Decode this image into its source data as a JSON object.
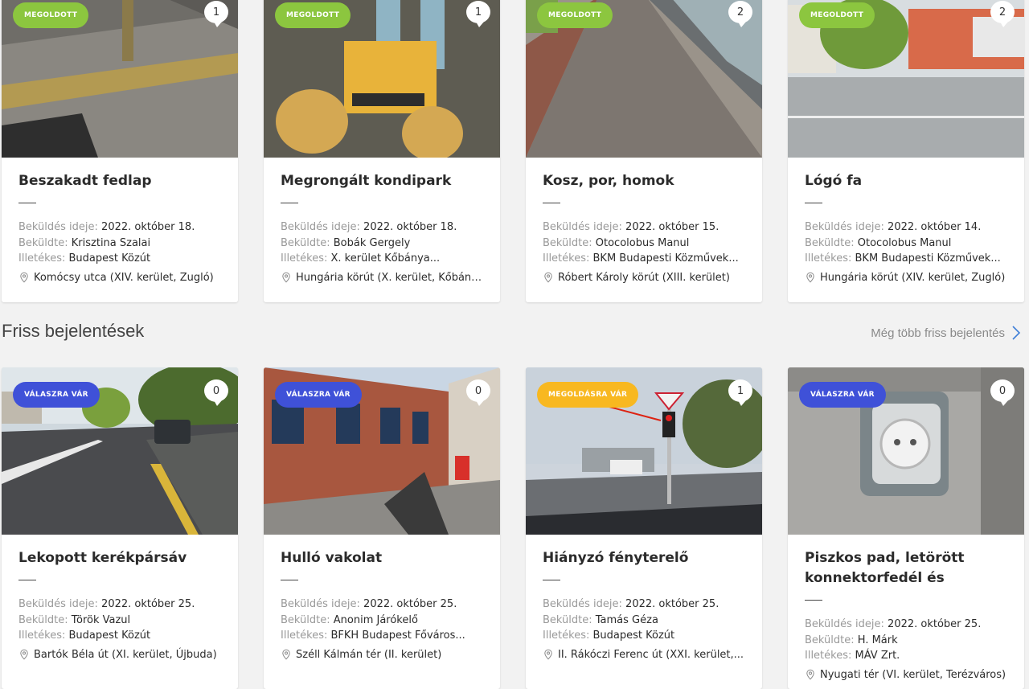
{
  "labels": {
    "sent_time": "Beküldés ideje:",
    "sender": "Beküldte:",
    "responsible": "Illetékes:"
  },
  "section": {
    "title": "Friss bejelentések",
    "more_link": "Még több friss bejelentés"
  },
  "colors": {
    "solved": "#8cc63f",
    "awaiting_reply": "#3f51d8",
    "awaiting_solution": "#f8b820"
  },
  "solved_cards": [
    {
      "badge": "MEGOLDOTT",
      "comments": "1",
      "title": "Beszakadt fedlap",
      "date": "2022. október 18.",
      "sender": "Krisztina Szalai",
      "responsible": "Budapest Közút",
      "location": "Komócsy utca (XIV. kerület, Zugló)"
    },
    {
      "badge": "MEGOLDOTT",
      "comments": "1",
      "title": "Megrongált kondipark",
      "date": "2022. október 18.",
      "sender": "Bobák Gergely",
      "responsible": "X. kerület Kőbánya...",
      "location": "Hungária körút (X. kerület, Kőbánya)"
    },
    {
      "badge": "MEGOLDOTT",
      "comments": "2",
      "title": "Kosz, por, homok",
      "date": "2022. október 15.",
      "sender": "Otocolobus Manul",
      "responsible": "BKM Budapesti Közművek...",
      "location": "Róbert Károly körút (XIII. kerület)"
    },
    {
      "badge": "MEGOLDOTT",
      "comments": "2",
      "title": "Lógó fa",
      "date": "2022. október 14.",
      "sender": "Otocolobus Manul",
      "responsible": "BKM Budapesti Közművek...",
      "location": "Hungária körút (XIV. kerület, Zugló)"
    }
  ],
  "fresh_cards": [
    {
      "badge": "VÁLASZRA VÁR",
      "comments": "0",
      "title": "Lekopott kerékpársáv",
      "date": "2022. október 25.",
      "sender": "Török Vazul",
      "responsible": "Budapest Közút",
      "location": "Bartók Béla út (XI. kerület, Újbuda)"
    },
    {
      "badge": "VÁLASZRA VÁR",
      "comments": "0",
      "title": "Hulló vakolat",
      "date": "2022. október 25.",
      "sender": "Anonim Járókelő",
      "responsible": "BFKH Budapest Főváros...",
      "location": "Széll Kálmán tér (II. kerület)"
    },
    {
      "badge": "MEGOLDÁSRA VÁR",
      "comments": "1",
      "title": "Hiányzó fényterelő",
      "date": "2022. október 25.",
      "sender": "Tamás Géza",
      "responsible": "Budapest Közút",
      "location": "II. Rákóczi Ferenc út (XXI. kerület,..."
    },
    {
      "badge": "VÁLASZRA VÁR",
      "comments": "0",
      "title": "Piszkos pad, letörött konnektorfedél és elmozdult...",
      "date": "2022. október 25.",
      "sender": "H. Márk",
      "responsible": "MÁV Zrt.",
      "location": "Nyugati tér (VI. kerület, Terézváros)"
    }
  ]
}
